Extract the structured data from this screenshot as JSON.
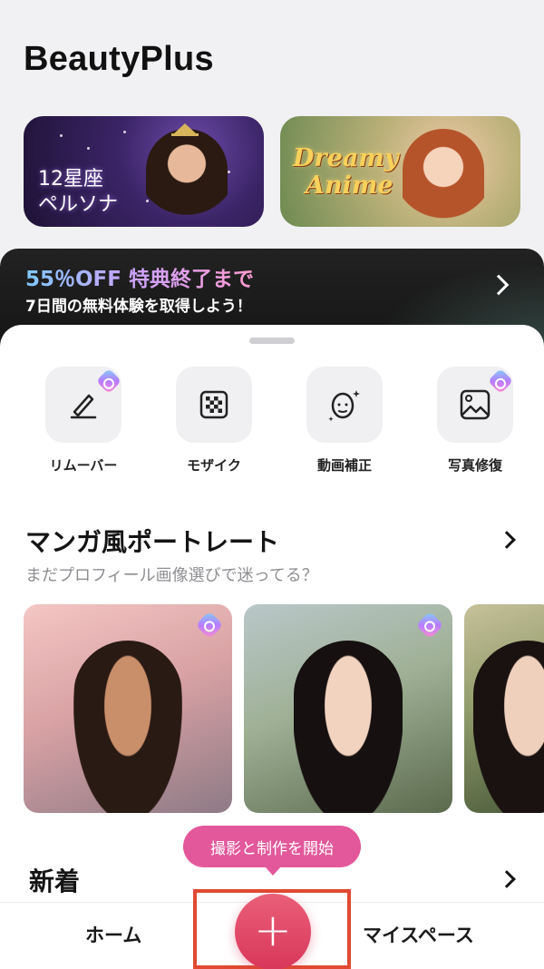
{
  "app": {
    "title": "BeautyPlus"
  },
  "banners": [
    {
      "text": "12星座\nペルソナ"
    },
    {
      "text": "Dreamy\nAnime"
    }
  ],
  "promo": {
    "title": "55％OFF 特典終了まで",
    "subtitle": "7日間の無料体験を取得しよう！"
  },
  "tools": [
    {
      "label": "リムーバー",
      "icon": "eraser-pen-icon",
      "premium": true
    },
    {
      "label": "モザイク",
      "icon": "mosaic-icon",
      "premium": false
    },
    {
      "label": "動画補正",
      "icon": "face-sparkle-icon",
      "premium": false
    },
    {
      "label": "写真修復",
      "icon": "photo-repair-icon",
      "premium": true
    }
  ],
  "manga": {
    "title": "マンガ風ポートレート",
    "subtitle": "まだプロフィール画像選びで迷ってる？"
  },
  "new_section": {
    "title": "新着"
  },
  "tooltip": {
    "text": "撮影と制作を開始"
  },
  "nav": {
    "home": "ホーム",
    "create": "+",
    "myspace": "マイスペース"
  },
  "colors": {
    "accent": "#d8375a",
    "tooltip": "#e2589b",
    "highlight": "#e04a31"
  }
}
